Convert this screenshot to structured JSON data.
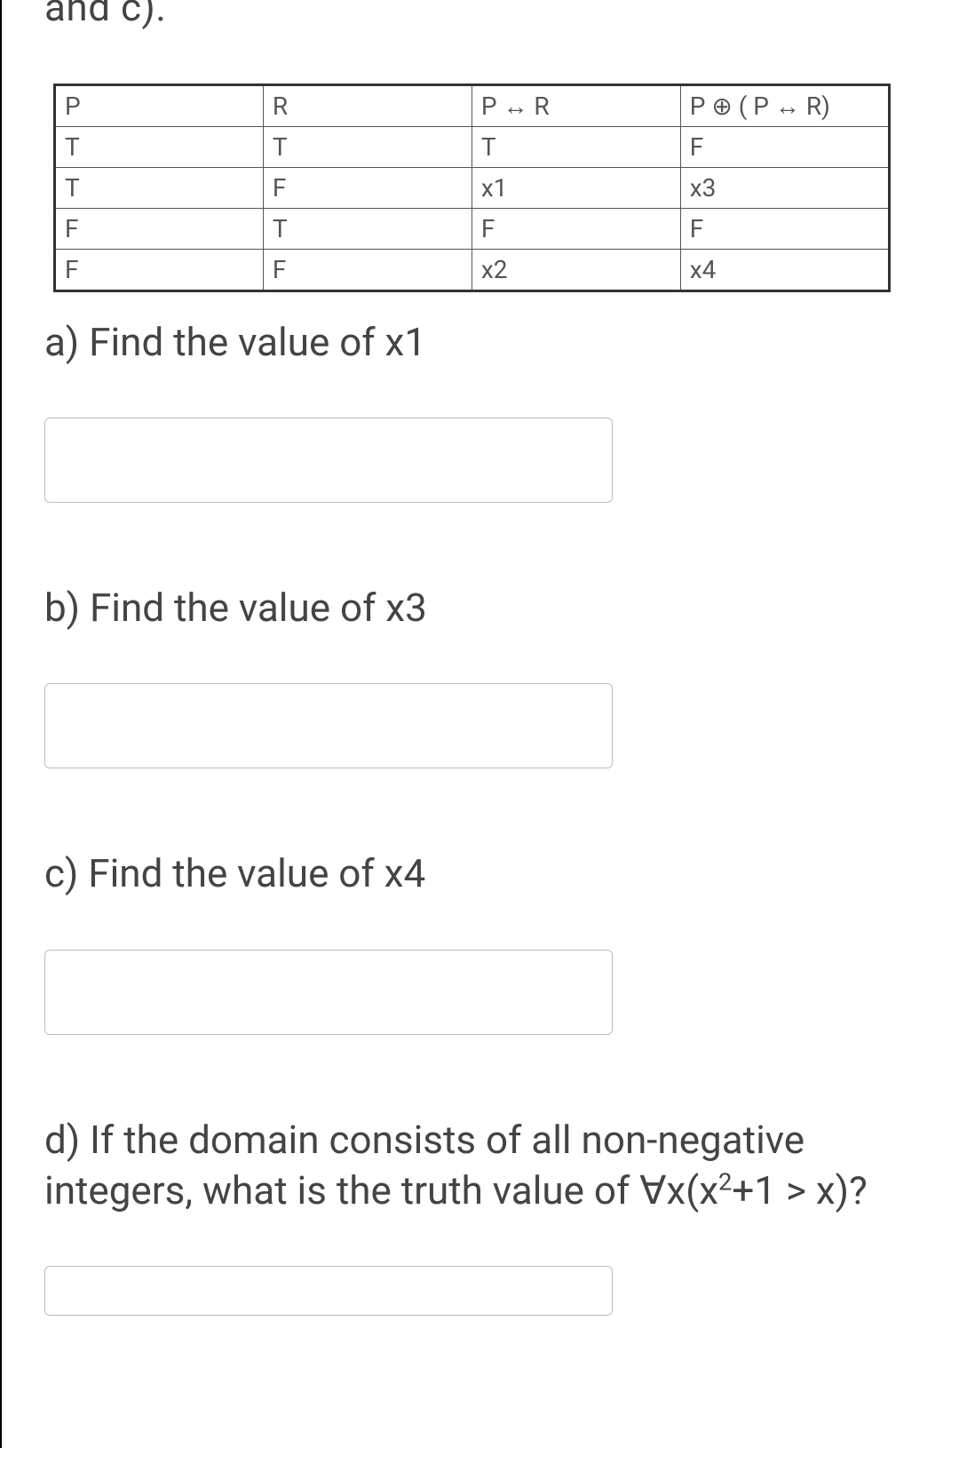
{
  "top_fragment": "and c).",
  "table": {
    "headers": [
      "P",
      "R",
      "P ↔ R",
      "P ⊕ ( P ↔ R)"
    ],
    "rows": [
      [
        "T",
        "T",
        "T",
        "F"
      ],
      [
        "T",
        "F",
        "x1",
        "x3"
      ],
      [
        "F",
        "T",
        "F",
        "F"
      ],
      [
        "F",
        "F",
        "x2",
        "x4"
      ]
    ]
  },
  "questions": {
    "a": "a) Find the value of x1",
    "b": "b) Find the value of x3",
    "c": "c) Find the value of x4",
    "d_prefix": "d) If the domain consists of all non-negative integers, what is the truth value of ∀x(x",
    "d_exp": "2",
    "d_suffix": "+1 > x)?"
  },
  "answers": {
    "a": "",
    "b": "",
    "c": "",
    "d": ""
  }
}
